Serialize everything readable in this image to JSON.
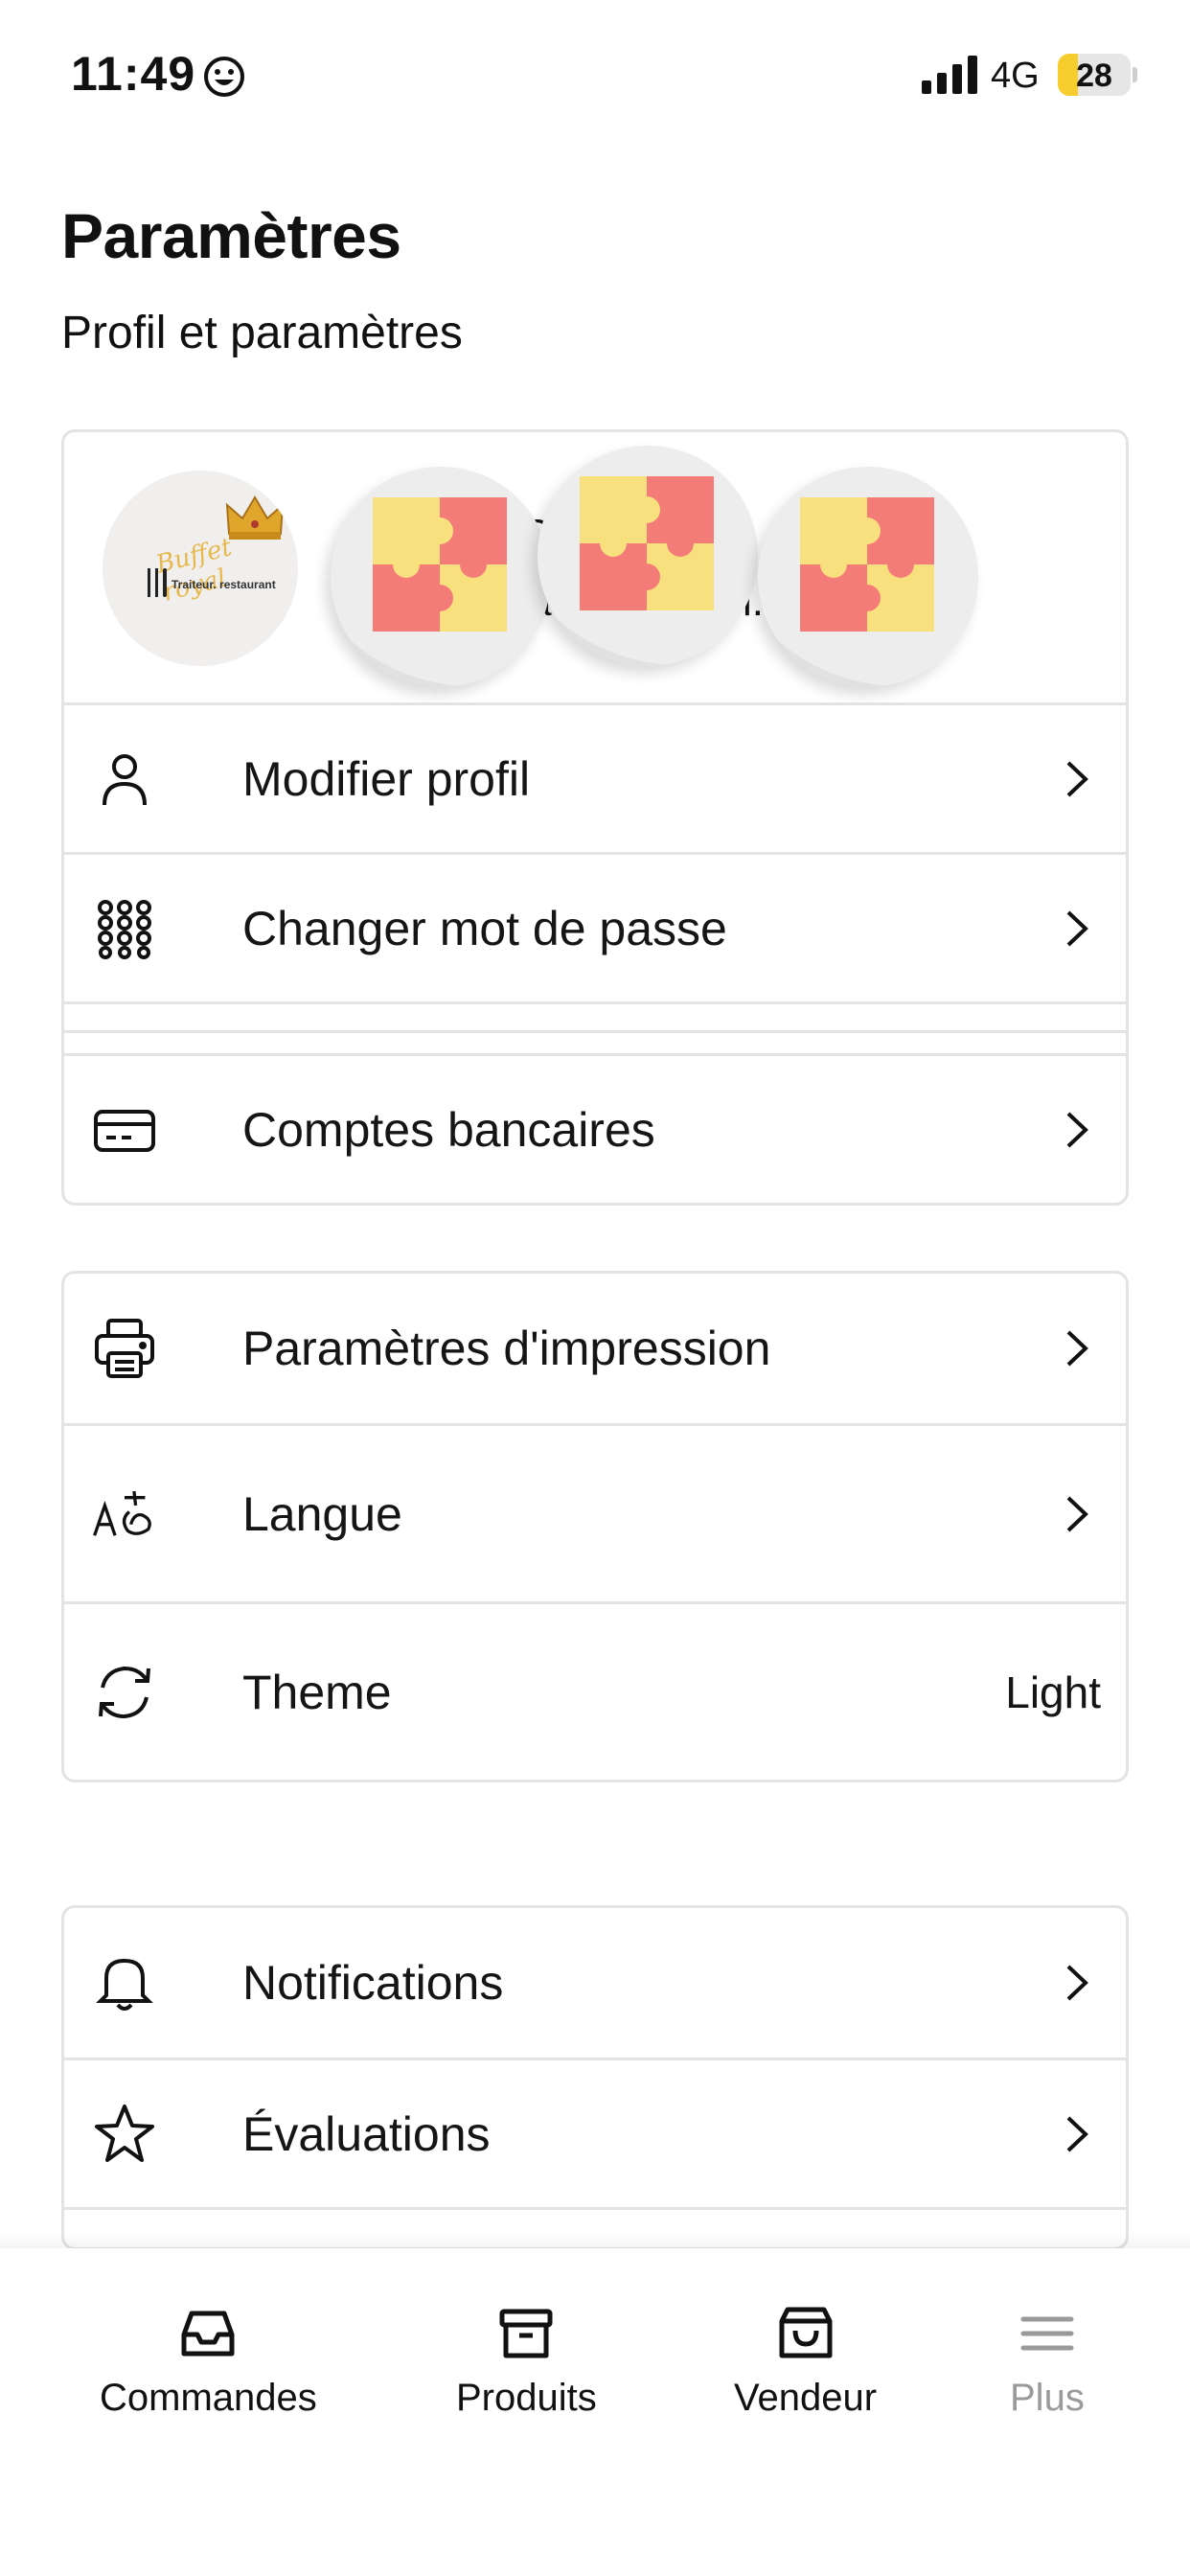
{
  "status_bar": {
    "time": "11:49",
    "network": "4G",
    "battery_level": "28",
    "battery_fraction": 0.28,
    "battery_color": "#f7cd2e",
    "icons": [
      "smiley-icon",
      "signal-icon",
      "battery-icon"
    ]
  },
  "header": {
    "title": "Paramètres",
    "subtitle": "Profil et paramètres"
  },
  "profile": {
    "logo_script": "Buffet royal",
    "logo_tagline": "Traiteur. restaurant",
    "peek_text_1": "R",
    "peek_text_2": "a",
    "peek_text_3": "i."
  },
  "account_section": {
    "items": [
      {
        "label": "Modifier profil",
        "icon": "person-icon"
      },
      {
        "label": "Changer mot de passe",
        "icon": "keypad-icon"
      },
      {
        "label": "Comptes bancaires",
        "icon": "credit-card-icon"
      }
    ]
  },
  "app_section": {
    "items": [
      {
        "label": "Paramètres d'impression",
        "icon": "printer-icon"
      },
      {
        "label": "Langue",
        "icon": "translate-icon"
      },
      {
        "label": "Theme",
        "icon": "refresh-icon",
        "value": "Light"
      }
    ]
  },
  "misc_section": {
    "items": [
      {
        "label": "Notifications",
        "icon": "bell-icon"
      },
      {
        "label": "Évaluations",
        "icon": "star-icon"
      }
    ]
  },
  "bottom_nav": {
    "items": [
      {
        "label": "Commandes",
        "icon": "inbox-icon"
      },
      {
        "label": "Produits",
        "icon": "archive-icon"
      },
      {
        "label": "Vendeur",
        "icon": "shopping-bag-icon"
      },
      {
        "label": "Plus",
        "icon": "menu-icon"
      }
    ],
    "inactive_color": "#9a9a9a",
    "puzzle_red": "#f47c78",
    "puzzle_yellow": "#f8e07f"
  }
}
